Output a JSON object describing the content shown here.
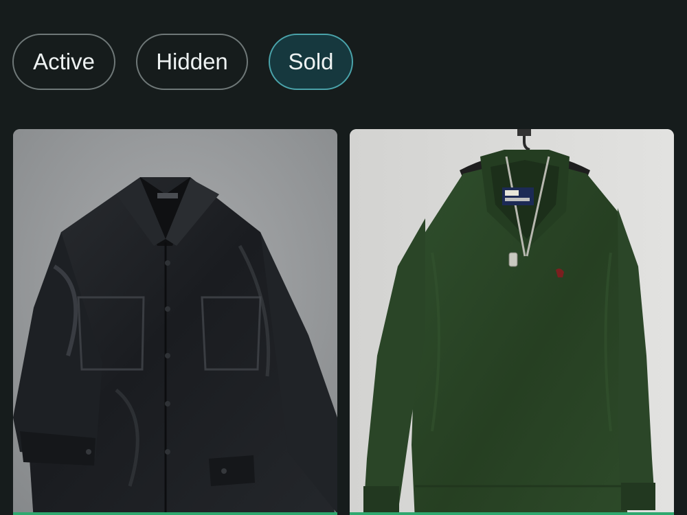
{
  "filters": {
    "active_label": "Active",
    "hidden_label": "Hidden",
    "sold_label": "Sold",
    "selected": "Sold"
  },
  "listings": [
    {
      "item": "black faux leather shirt jacket",
      "status_color": "#2fa86f"
    },
    {
      "item": "green quarter-zip pullover",
      "label_brand": "Polo",
      "label_subtext": "by Ralph Lauren",
      "status_color": "#2fa86f"
    }
  ],
  "colors": {
    "background": "#161c1c",
    "chip_border": "#6f7878",
    "chip_selected_bg": "#16383e",
    "chip_selected_border": "#4aa3aa"
  }
}
